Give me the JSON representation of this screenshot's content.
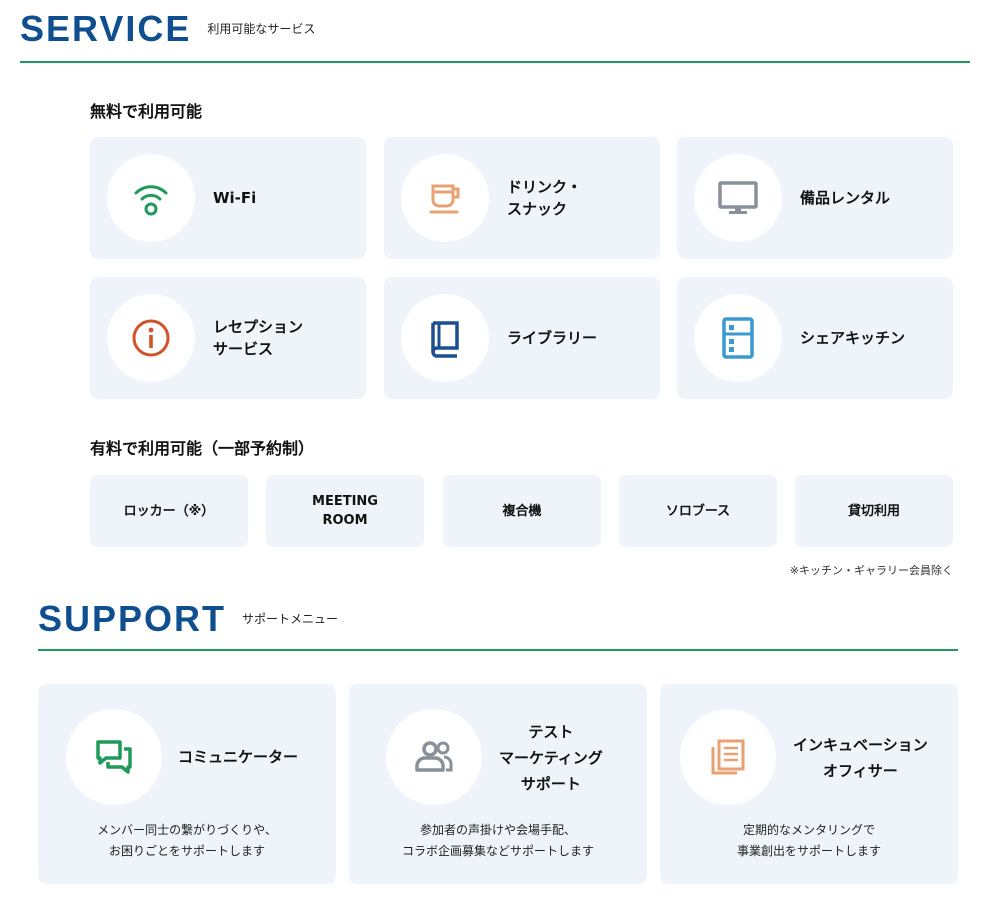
{
  "service": {
    "title": "SERVICE",
    "subtitle": "利用可能なサービス",
    "free_heading": "無料で利用可能",
    "free_items": [
      {
        "label": "Wi-Fi",
        "icon": "wifi-icon",
        "color": "#1f9a5a"
      },
      {
        "label": "ドリンク・\nスナック",
        "icon": "cup-icon",
        "color": "#e8a272"
      },
      {
        "label": "備品レンタル",
        "icon": "monitor-icon",
        "color": "#8a9099"
      },
      {
        "label": "レセプション\nサービス",
        "icon": "info-icon",
        "color": "#d2522a"
      },
      {
        "label": "ライブラリー",
        "icon": "book-icon",
        "color": "#1b4f8f"
      },
      {
        "label": "シェアキッチン",
        "icon": "fridge-icon",
        "color": "#3a9ad0"
      }
    ],
    "paid_heading": "有料で利用可能（一部予約制）",
    "paid_items": [
      "ロッカー（※）",
      "MEETING\nROOM",
      "複合機",
      "ソロブース",
      "貸切利用"
    ],
    "note": "※キッチン・ギャラリー会員除く"
  },
  "support": {
    "title": "SUPPORT",
    "subtitle": "サポートメニュー",
    "items": [
      {
        "title": "コミュニケーター",
        "desc": "メンバー同士の繋がりづくりや、\nお困りごとをサポートします",
        "icon": "chat-icon",
        "color": "#1f9a5a"
      },
      {
        "title": "テスト\nマーケティング\nサポート",
        "desc": "参加者の声掛けや会場手配、\nコラボ企画募集などサポートします",
        "icon": "people-icon",
        "color": "#8a9099"
      },
      {
        "title": "インキュベーション\nオフィサー",
        "desc": "定期的なメンタリングで\n事業創出をサポートします",
        "icon": "document-icon",
        "color": "#e8a272"
      }
    ]
  },
  "colors": {
    "brand_blue": "#0f4f8f",
    "rule_green": "#1f9a5a",
    "card_bg": "#eef4fa"
  }
}
